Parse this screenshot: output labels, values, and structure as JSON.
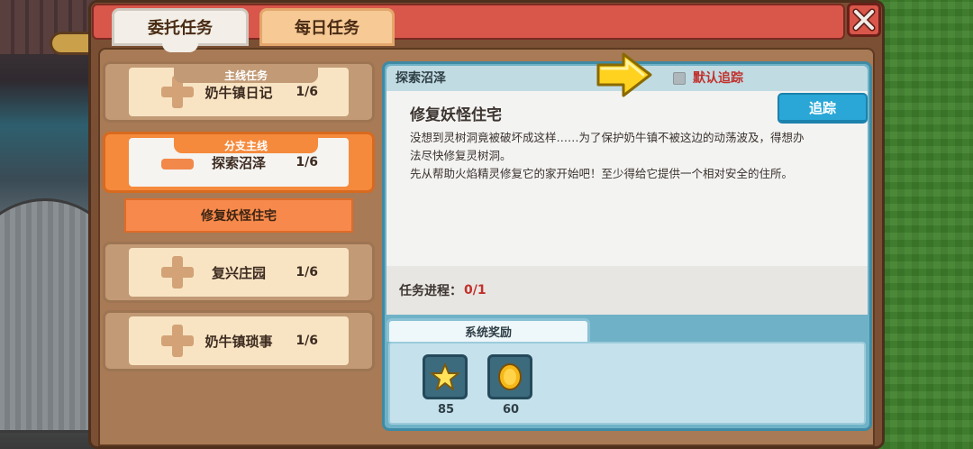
{
  "tabs": {
    "commission": "委托任务",
    "daily": "每日任务"
  },
  "quest_list": [
    {
      "tag": "主线任务",
      "name": "奶牛镇日记",
      "count": "1/6",
      "state": "collapsed"
    },
    {
      "tag": "分支主线",
      "name": "探索沼泽",
      "count": "1/6",
      "state": "expanded",
      "subitems": [
        "修复妖怪住宅"
      ]
    },
    {
      "tag": "",
      "name": "复兴庄园",
      "count": "1/6",
      "state": "collapsed"
    },
    {
      "tag": "",
      "name": "奶牛镇琐事",
      "count": "1/6",
      "state": "collapsed"
    }
  ],
  "detail": {
    "header_title": "探索沼泽",
    "default_track_label": "默认追踪",
    "default_track_checked": false,
    "task_title": "修复妖怪住宅",
    "track_button": "追踪",
    "description": [
      "没想到灵树洞竟被破坏成这样……为了保护奶牛镇不被这边的动荡波及，得想办",
      "法尽快修复灵树洞。",
      "先从帮助火焰精灵修复它的家开始吧！至少得给它提供一个相对安全的住所。"
    ],
    "progress_label": "任务进程：",
    "progress_value": "0/1",
    "reward_tab": "系统奖励",
    "rewards": [
      {
        "icon": "star-icon",
        "amount": "85"
      },
      {
        "icon": "gold-coin-icon",
        "amount": "60"
      }
    ]
  },
  "colors": {
    "title_bar": "#d8564a",
    "active_orange": "#f58a3c",
    "track_button": "#2aa7d6",
    "accent_red": "#c0322c"
  }
}
